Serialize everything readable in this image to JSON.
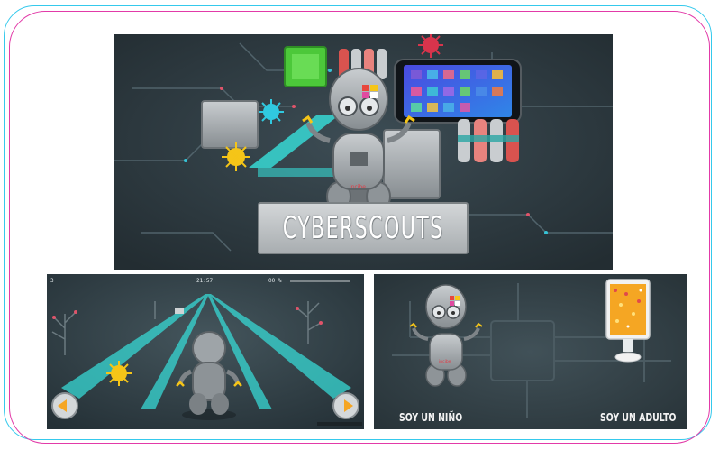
{
  "hero": {
    "title": "CYBERSCOUTS",
    "badge_text": "incibe"
  },
  "game": {
    "hud_lives": "3",
    "hud_timer": "21:57",
    "hud_percent": "00 %",
    "progress": 0.0
  },
  "select": {
    "child_label": "SOY UN NIÑO",
    "adult_label": "SOY UN ADULTO",
    "badge_text": "incibe"
  },
  "colors": {
    "frame_cyan": "#35c9ec",
    "frame_pink": "#e23aa8",
    "panel_bg": "#2d3a40",
    "beam": "#37d8d4",
    "arrow_orange": "#f5a623",
    "chip_green": "#4cc83a"
  }
}
